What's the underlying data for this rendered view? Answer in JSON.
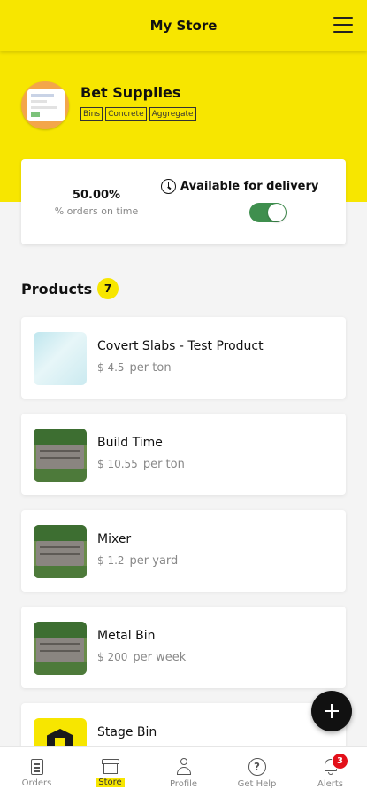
{
  "header": {
    "title": "My Store"
  },
  "store": {
    "name": "Bet Supplies",
    "tags": [
      "Bins",
      "Concrete",
      "Aggregate"
    ]
  },
  "stats": {
    "on_time_pct": "50.00%",
    "on_time_label": "% orders on time",
    "delivery_label": "Available for delivery",
    "delivery_enabled": true
  },
  "products": {
    "heading": "Products",
    "count": "7",
    "items": [
      {
        "name": "Covert Slabs - Test Product",
        "price": "$ 4.5",
        "unit": "per ton",
        "thumb": "slab-image"
      },
      {
        "name": "Build Time",
        "price": "$ 10.55",
        "unit": "per ton",
        "thumb": "bin-image"
      },
      {
        "name": "Mixer",
        "price": "$ 1.2",
        "unit": "per yard",
        "thumb": "bin-image"
      },
      {
        "name": "Metal Bin",
        "price": "$ 200",
        "unit": "per week",
        "thumb": "bin-image"
      },
      {
        "name": "Stage Bin",
        "price": "",
        "unit": "",
        "thumb": "logo-image"
      }
    ]
  },
  "nav": {
    "items": [
      {
        "label": "Orders",
        "icon": "orders-icon"
      },
      {
        "label": "Store",
        "icon": "store-icon",
        "active": true
      },
      {
        "label": "Profile",
        "icon": "profile-icon"
      },
      {
        "label": "Get Help",
        "icon": "help-icon"
      },
      {
        "label": "Alerts",
        "icon": "bell-icon",
        "badge": "3"
      }
    ]
  },
  "colors": {
    "brand": "#f7e600",
    "toggle_on": "#3f8f4e",
    "badge": "#e3101a"
  }
}
